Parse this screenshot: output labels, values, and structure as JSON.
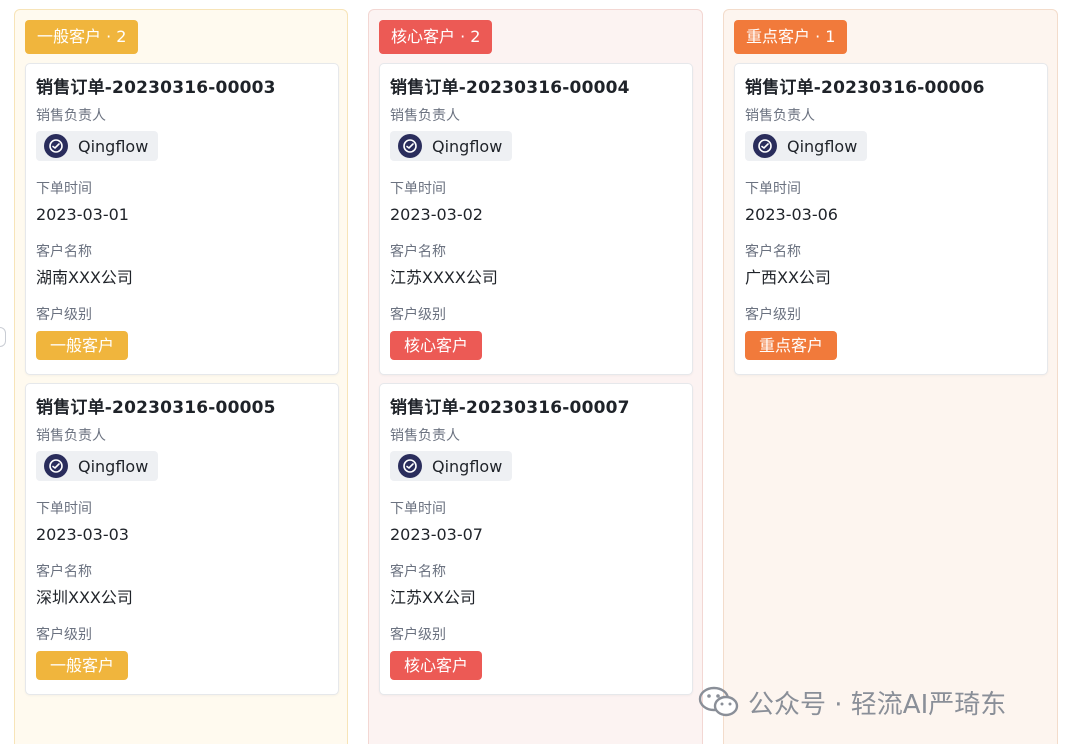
{
  "columns": [
    {
      "tag": "一般客户 · 2",
      "cards": [
        {
          "title": "销售订单-20230316-00003",
          "owner_label": "销售负责人",
          "owner": "Qingflow",
          "date_label": "下单时间",
          "date": "2023-03-01",
          "customer_label": "客户名称",
          "customer": "湖南XXX公司",
          "level_label": "客户级别",
          "level": "一般客户"
        },
        {
          "title": "销售订单-20230316-00005",
          "owner_label": "销售负责人",
          "owner": "Qingflow",
          "date_label": "下单时间",
          "date": "2023-03-03",
          "customer_label": "客户名称",
          "customer": "深圳XXX公司",
          "level_label": "客户级别",
          "level": "一般客户"
        }
      ]
    },
    {
      "tag": "核心客户 · 2",
      "cards": [
        {
          "title": "销售订单-20230316-00004",
          "owner_label": "销售负责人",
          "owner": "Qingflow",
          "date_label": "下单时间",
          "date": "2023-03-02",
          "customer_label": "客户名称",
          "customer": "江苏XXXX公司",
          "level_label": "客户级别",
          "level": "核心客户"
        },
        {
          "title": "销售订单-20230316-00007",
          "owner_label": "销售负责人",
          "owner": "Qingflow",
          "date_label": "下单时间",
          "date": "2023-03-07",
          "customer_label": "客户名称",
          "customer": "江苏XX公司",
          "level_label": "客户级别",
          "level": "核心客户"
        }
      ]
    },
    {
      "tag": "重点客户 · 1",
      "cards": [
        {
          "title": "销售订单-20230316-00006",
          "owner_label": "销售负责人",
          "owner": "Qingflow",
          "date_label": "下单时间",
          "date": "2023-03-06",
          "customer_label": "客户名称",
          "customer": "广西XX公司",
          "level_label": "客户级别",
          "level": "重点客户"
        }
      ]
    }
  ],
  "colors": {
    "general": "#f0b53d",
    "core": "#ec5a55",
    "key": "#f17a3b"
  },
  "icons": {
    "avatar": "qingflow-logo-icon",
    "watermark": "wechat-icon"
  },
  "watermark": "公众号 · 轻流AI严琦东"
}
